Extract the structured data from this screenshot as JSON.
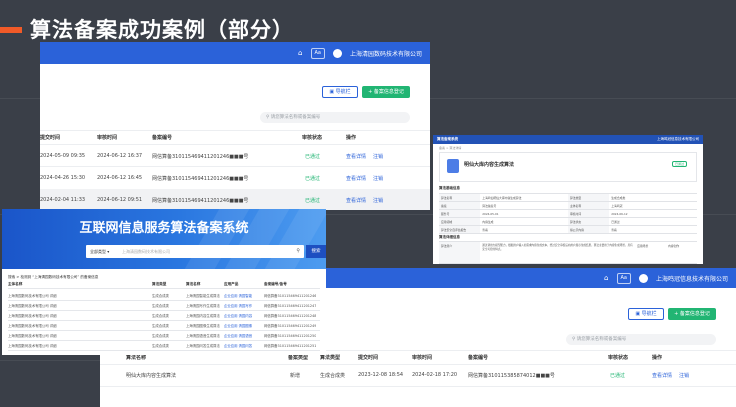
{
  "slide": {
    "title": "算法备案成功案例（部分）"
  },
  "colors": {
    "accent": "#f05a28",
    "brand_blue": "#2b62d9",
    "success_green": "#21b573"
  },
  "shot_top": {
    "company": "上海清园数码技术有限公司",
    "lang_chip": "Aa",
    "home_icon": "home-icon",
    "user_icon": "user-avatar-icon",
    "btn_guide": "导航栏",
    "btn_add": "+ 备案信息登记",
    "search_placeholder": "请您算法名称或备案编号",
    "headers": {
      "date": "提交时间",
      "review": "审核时间",
      "num": "备案编号",
      "status": "审核状态",
      "ops": "操作"
    },
    "rows": [
      {
        "date": "2024-05-09 09:35",
        "review": "2024-06-12 16:37",
        "num": "网信算备310115469411201246■■■号",
        "status": "已通过",
        "view": "查看详情",
        "del": "注销"
      },
      {
        "date": "2024-04-26 15:30",
        "review": "2024-06-12 16:45",
        "num": "网信算备310115469411201246■■■号",
        "status": "已通过",
        "view": "查看详情",
        "del": "注销"
      },
      {
        "date": "2024-02-04 11:33",
        "review": "2024-06-12 09:51",
        "num": "网信算备310115469411201246■■■号",
        "status": "已通过",
        "view": "查看详情",
        "del": "注销"
      }
    ]
  },
  "shot_detail": {
    "bar_title": "算法备案系统",
    "bar_right": "上海鸣冠信息技术有限公司",
    "crumb": "备案 > 算法详情",
    "name": "明仙大库内容生成算法",
    "tag": "已通过",
    "sec_basic": "算法基础信息",
    "sec_detail": "算法详细信息",
    "basic": [
      [
        "算法名称",
        "上海鸣仙明仙大库内容生成算法",
        "算法类型",
        "生成合成类"
      ],
      [
        "备案",
        "算法备案号",
        "主体名称",
        "上海鸣冠"
      ],
      [
        "服务号",
        "2024-05-01",
        "审核时间",
        "2024-06-12"
      ],
      [
        "应用领域",
        "内容生成",
        "算法状态",
        "已通过"
      ],
      [
        "算法安全自评估报告",
        "查看",
        "拟公示内容",
        "查看"
      ]
    ],
    "intro_label": "算法简介",
    "intro": "通过调用大模型能力，根据用户输入的需求内容生成文本，经过安全审核后向用户展示生成结果，算法主要用于内容生成场景，具有安全可控的特点。",
    "intro_label2": "应用场景",
    "intro_val2": "内容创作"
  },
  "shot_system": {
    "title": "互联网信息服务算法备案系统",
    "select": "全部类型",
    "query": "上海清园数码技术有限公司",
    "btn": "搜索",
    "crumb": "搜索 > 检测到 “上海清园数码技术有限公司” 的备案信息",
    "headers": [
      "主体名称",
      "算法类型",
      "算法名称",
      "应用产品",
      "备案编号/备号"
    ],
    "rows": [
      [
        "上海清园数码技术有限公司 详细",
        "生成合成类",
        "上海清园智能生成算法",
        "企业应用 清园智能",
        "网信算备310115469411201246"
      ],
      [
        "上海清园数码技术有限公司 详细",
        "生成合成类",
        "上海清园写作生成算法",
        "企业应用 清园写作",
        "网信算备310115469411201247"
      ],
      [
        "上海清园数码技术有限公司 详细",
        "生成合成类",
        "上海清园内容生成算法",
        "企业应用 清园内容",
        "网信算备310115469411201248"
      ],
      [
        "上海清园数码技术有限公司 详细",
        "生成合成类",
        "上海清园图像生成算法",
        "企业应用 清园图像",
        "网信算备310115469411201249"
      ],
      [
        "上海清园数码技术有限公司 详细",
        "生成合成类",
        "上海清园语音生成算法",
        "企业应用 清园语音",
        "网信算备310115469411201250"
      ],
      [
        "上海清园数码技术有限公司 详细",
        "生成合成类",
        "上海清园问答生成算法",
        "企业应用 清园问答",
        "网信算备310115469411201251"
      ]
    ]
  },
  "shot_bottom": {
    "company": "上海鸣冠信息技术有限公司",
    "lang_chip": "Aa",
    "btn_guide": "导航栏",
    "btn_add": "+ 备案信息登记",
    "search_placeholder": "请您算法名称或备案编号",
    "headers": {
      "name": "算法名称",
      "type": "备案类型",
      "cat": "算法类型",
      "date": "提交时间",
      "review": "审核时间",
      "num": "备案编号",
      "status": "审核状态",
      "ops": "操作"
    },
    "row": {
      "name": "明仙大库内容生成算法",
      "type": "新增",
      "cat": "生成合成类",
      "date": "2023-12-08 18:54",
      "review": "2024-02-18 17:20",
      "num": "网信算备310115385874012■■■号",
      "status": "已通过",
      "view": "查看详情",
      "del": "注销"
    }
  }
}
